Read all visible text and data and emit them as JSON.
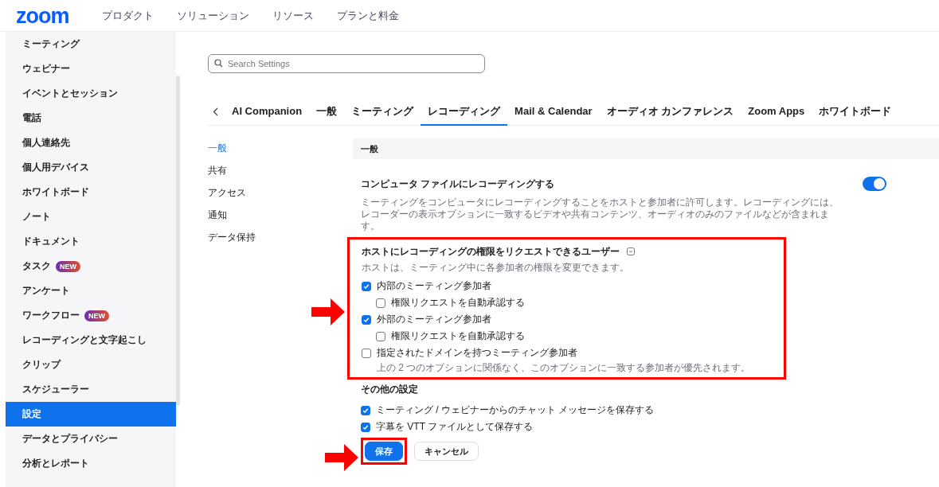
{
  "logo": "zoom",
  "nav": [
    "プロダクト",
    "ソリューション",
    "リソース",
    "プランと料金"
  ],
  "sidebar": {
    "items": [
      {
        "label": "ミーティング",
        "selected": false
      },
      {
        "label": "ウェビナー",
        "selected": false
      },
      {
        "label": "イベントとセッション",
        "selected": false
      },
      {
        "label": "電話",
        "selected": false
      },
      {
        "label": "個人連絡先",
        "selected": false
      },
      {
        "label": "個人用デバイス",
        "selected": false
      },
      {
        "label": "ホワイトボード",
        "selected": false
      },
      {
        "label": "ノート",
        "selected": false
      },
      {
        "label": "ドキュメント",
        "selected": false
      },
      {
        "label": "タスク",
        "badge": "NEW",
        "selected": false
      },
      {
        "label": "アンケート",
        "selected": false
      },
      {
        "label": "ワークフロー",
        "badge": "NEW",
        "selected": false
      },
      {
        "label": "レコーディングと文字起こし",
        "selected": false
      },
      {
        "label": "クリップ",
        "selected": false
      },
      {
        "label": "スケジューラー",
        "selected": false
      },
      {
        "label": "設定",
        "selected": true
      },
      {
        "label": "データとプライバシー",
        "selected": false
      },
      {
        "label": "分析とレポート",
        "selected": false
      }
    ]
  },
  "search": {
    "placeholder": "Search Settings"
  },
  "tabs": [
    {
      "label": "AI Companion",
      "selected": false
    },
    {
      "label": "一般",
      "selected": false
    },
    {
      "label": "ミーティング",
      "selected": false
    },
    {
      "label": "レコーディング",
      "selected": true
    },
    {
      "label": "Mail & Calendar",
      "selected": false
    },
    {
      "label": "オーディオ カンファレンス",
      "selected": false
    },
    {
      "label": "Zoom Apps",
      "selected": false
    },
    {
      "label": "ホワイトボード",
      "selected": false
    }
  ],
  "subnav": [
    {
      "label": "一般",
      "selected": true
    },
    {
      "label": "共有",
      "selected": false
    },
    {
      "label": "アクセス",
      "selected": false
    },
    {
      "label": "通知",
      "selected": false
    },
    {
      "label": "データ保持",
      "selected": false
    }
  ],
  "section_title": "一般",
  "setting": {
    "title": "コンピュータ ファイルにレコーディングする",
    "description": "ミーティングをコンピュータにレコーディングすることをホストと参加者に許可します。レコーディングには、レコーダーの表示オプションに一致するビデオや共有コンテンツ、オーディオのみのファイルなどが含まれます。",
    "on": true
  },
  "permission_group": {
    "title": "ホストにレコーディングの権限をリクエストできるユーザー",
    "description": "ホストは、ミーティング中に各参加者の権限を変更できます。",
    "highlighted": true,
    "options": [
      {
        "label": "内部のミーティング参加者",
        "checked": true,
        "children": [
          {
            "label": "権限リクエストを自動承認する",
            "checked": false
          }
        ]
      },
      {
        "label": "外部のミーティング参加者",
        "checked": true,
        "children": [
          {
            "label": "権限リクエストを自動承認する",
            "checked": false
          }
        ]
      },
      {
        "label": "指定されたドメインを持つミーティング参加者",
        "checked": false,
        "note": "上の 2 つのオプションに関係なく、このオプションに一致する参加者が優先されます。"
      }
    ]
  },
  "other": {
    "title": "その他の設定",
    "options": [
      {
        "label": "ミーティング / ウェビナーからのチャット メッセージを保存する",
        "checked": true
      },
      {
        "label": "字幕を VTT ファイルとして保存する",
        "checked": true
      }
    ]
  },
  "buttons": [
    {
      "label": "保存",
      "kind": "primary",
      "highlighted": true
    },
    {
      "label": "キャンセル",
      "kind": "secondary",
      "highlighted": false
    }
  ]
}
